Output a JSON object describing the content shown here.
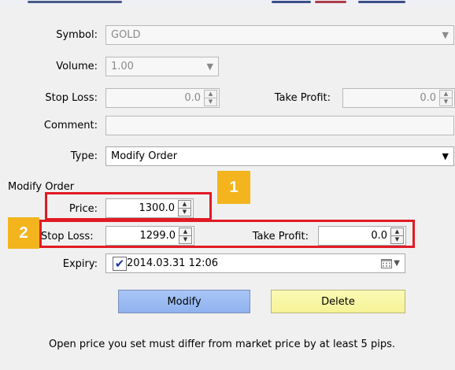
{
  "symbol": {
    "label": "Symbol:",
    "value": "GOLD"
  },
  "volume": {
    "label": "Volume:",
    "value": "1.00"
  },
  "stop_loss_top": {
    "label": "Stop Loss:",
    "value": "0.0"
  },
  "take_profit_top": {
    "label": "Take Profit:",
    "value": "0.0"
  },
  "comment": {
    "label": "Comment:",
    "value": ""
  },
  "type": {
    "label": "Type:",
    "value": "Modify Order"
  },
  "modify_order": {
    "section_label": "Modify Order",
    "price": {
      "label": "Price:",
      "value": "1300.0"
    },
    "stop_loss": {
      "label": "Stop Loss:",
      "value": "1299.0"
    },
    "take_profit": {
      "label": "Take Profit:",
      "value": "0.0"
    },
    "expiry": {
      "label": "Expiry:",
      "checked": true,
      "value": "2014.03.31 12:06"
    }
  },
  "badges": {
    "one": "1",
    "two": "2"
  },
  "buttons": {
    "modify": "Modify",
    "delete": "Delete"
  },
  "info_text": "Open price you set must differ from market price by at least 5 pips.",
  "colors": {
    "highlight": "#e01b24",
    "badge": "#f3b41e",
    "modify_button": "#9ab9f2",
    "delete_button": "#f8f6a5"
  }
}
